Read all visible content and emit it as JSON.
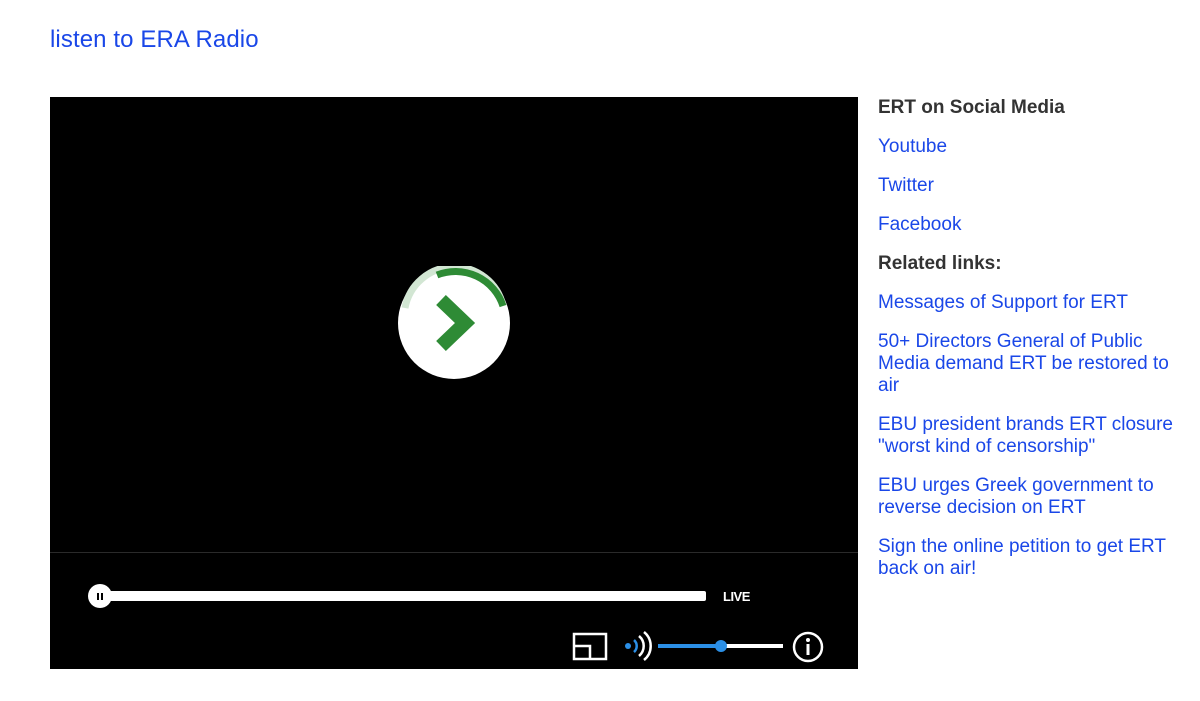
{
  "header": {
    "link_text": "listen to ERA Radio"
  },
  "player": {
    "live_label": "LIVE",
    "volume_level": 0.5,
    "colors": {
      "accent": "#2b8fe6",
      "spinner": "#2e8b35",
      "background": "#000000"
    },
    "icons": [
      "play-arrow-icon",
      "pause-icon",
      "cast-icon",
      "volume-icon",
      "info-icon"
    ]
  },
  "sidebar": {
    "social_heading": "ERT on Social Media",
    "social_links": [
      {
        "label": "Youtube"
      },
      {
        "label": "Twitter"
      },
      {
        "label": "Facebook"
      }
    ],
    "related_heading": "Related links:",
    "related_links": [
      {
        "label": "Messages of Support for ERT"
      },
      {
        "label": "50+ Directors General of Public Media demand ERT be restored to air"
      },
      {
        "label": "EBU president brands ERT closure \"worst kind of censorship\""
      },
      {
        "label": "EBU urges Greek government to reverse decision on ERT"
      },
      {
        "label": "Sign the online petition to get ERT back on air!"
      }
    ]
  }
}
